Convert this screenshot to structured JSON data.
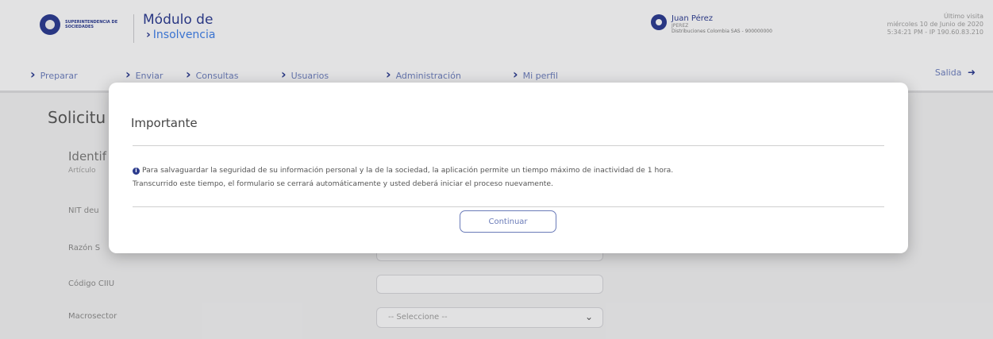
{
  "header": {
    "logo_text": "SUPERINTENDENCIA DE SOCIEDADES",
    "app_title": "Módulo de",
    "app_subtitle": "Insolvencia",
    "user": {
      "name": "Juan Pérez",
      "role": "JPEREZ",
      "org": "Distribuciones Colombia SAS - 900000000"
    },
    "last_visit": {
      "label": "Último visita",
      "date": "miércoles 10 de Junio de 2020",
      "time": "5:34:21 PM - IP 190.60.83.210"
    }
  },
  "nav": {
    "items": [
      "Preparar",
      "Enviar",
      "Consultas",
      "Usuarios",
      "Administración",
      "Mi perfil"
    ],
    "logout": "Salida"
  },
  "form": {
    "title": "Solicitu",
    "section_title": "Identif",
    "section_sub": "Artículo",
    "fields": [
      {
        "label": "NIT deu"
      },
      {
        "label": "Razón S"
      },
      {
        "label": "Código CIIU",
        "value": ""
      },
      {
        "label": "Macrosector",
        "selected": "-- Seleccione --"
      }
    ]
  },
  "modal": {
    "title": "Importante",
    "message_line1": "Para salvaguardar la seguridad de su información personal y la de la sociedad, la aplicación permite un tiempo máximo de inactividad de 1 hora.",
    "message_line2": "Transcurrido este tiempo, el formulario se cerrará automáticamente y usted deberá iniciar el proceso nuevamente.",
    "button_label": "Continuar"
  },
  "icons": {
    "logo": "supersociedades-logo-icon",
    "user": "user-avatar-icon",
    "logout": "logout-icon",
    "info": "info-icon",
    "chevron": "chevron-right-icon"
  },
  "colors": {
    "brand": "#2b3a8c",
    "accent": "#3d7be0",
    "nav_text": "#6a7bb8"
  }
}
